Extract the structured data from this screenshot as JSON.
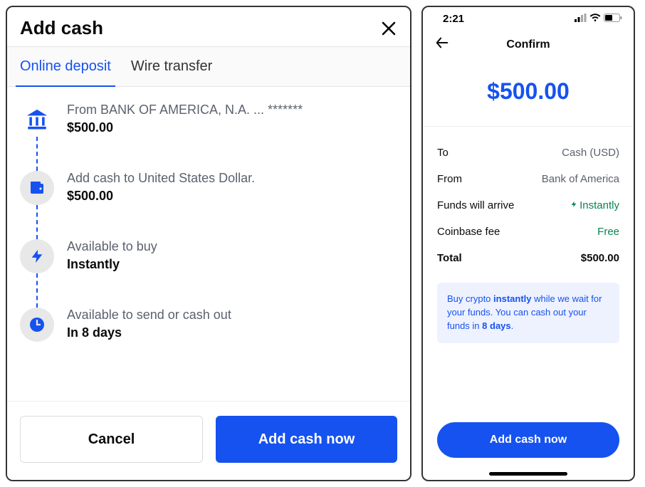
{
  "left": {
    "title": "Add cash",
    "tabs": {
      "online_deposit": "Online deposit",
      "wire_transfer": "Wire transfer"
    },
    "steps": {
      "from": {
        "label": "From BANK OF AMERICA, N.A. ... *******",
        "value": "$500.00"
      },
      "to": {
        "label": "Add cash to United States Dollar.",
        "value": "$500.00"
      },
      "buy": {
        "label": "Available to buy",
        "value": "Instantly"
      },
      "cashout": {
        "label": "Available to send or cash out",
        "value": "In 8 days"
      }
    },
    "buttons": {
      "cancel": "Cancel",
      "confirm": "Add cash now"
    }
  },
  "right": {
    "status": {
      "time": "2:21"
    },
    "header_title": "Confirm",
    "amount": "$500.00",
    "rows": {
      "to": {
        "k": "To",
        "v": "Cash (USD)"
      },
      "from": {
        "k": "From",
        "v": "Bank of America"
      },
      "arrive": {
        "k": "Funds will arrive",
        "v": "Instantly"
      },
      "fee": {
        "k": "Coinbase fee",
        "v": "Free"
      },
      "total": {
        "k": "Total",
        "v": "$500.00"
      }
    },
    "info_card": {
      "pre": "Buy crypto ",
      "b1": "instantly",
      "mid": " while we wait for your funds. You can cash out your funds in ",
      "b2": "8 days",
      "post": "."
    },
    "button": "Add cash now"
  },
  "colors": {
    "accent": "#1652f0",
    "green": "#098551"
  }
}
